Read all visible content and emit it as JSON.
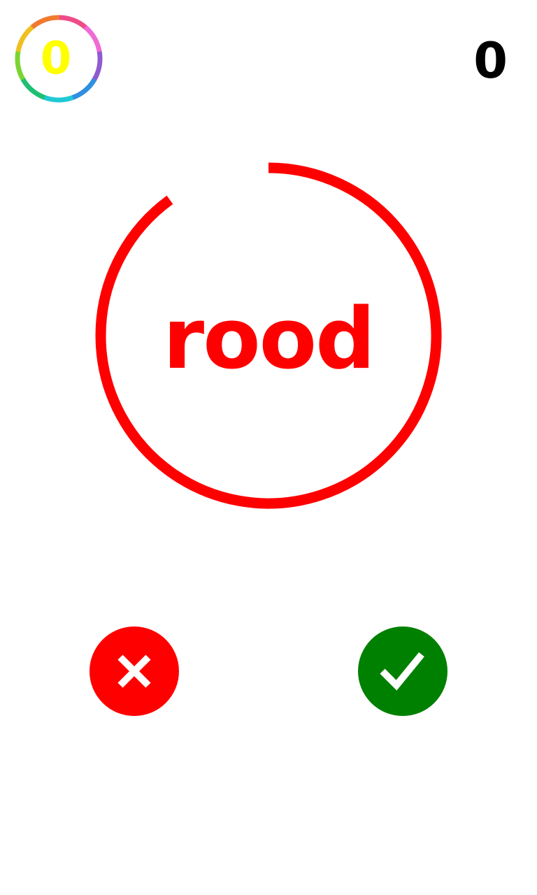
{
  "best_score": {
    "value": "0",
    "color": "#ffff00"
  },
  "score": {
    "value": "0",
    "color": "#000000"
  },
  "challenge": {
    "word": "rood",
    "word_color": "#ff0000",
    "timer_color": "#ff0000",
    "timer_remaining_fraction": 0.9
  },
  "buttons": {
    "no": {
      "icon": "close-icon",
      "color": "#ff0000"
    },
    "yes": {
      "icon": "checkmark-icon",
      "color": "#008000"
    }
  },
  "badge_ring_colors": [
    "#ee4b87",
    "#f06ad6",
    "#8f5bd0",
    "#2f8fe0",
    "#21c9d6",
    "#1fbf73",
    "#7bd430",
    "#f0c020",
    "#f07a30"
  ]
}
